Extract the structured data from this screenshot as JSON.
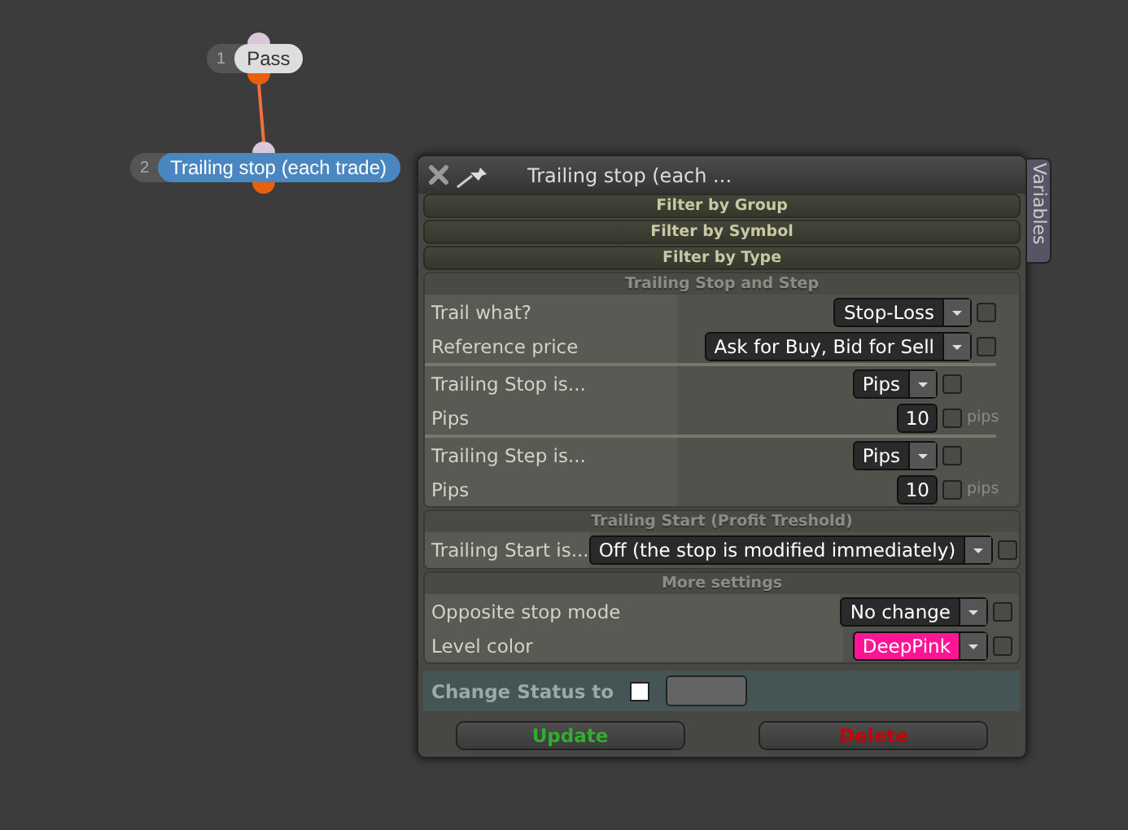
{
  "nodes": [
    {
      "number": "1",
      "label": "Pass",
      "selected": false
    },
    {
      "number": "2",
      "label": "Trailing stop (each trade)",
      "selected": true
    }
  ],
  "panel": {
    "title": "Trailing stop (each ...",
    "side_tab": "Variables",
    "filters": [
      "Filter by Group",
      "Filter by Symbol",
      "Filter by Type"
    ],
    "sections": [
      {
        "title": "Trailing Stop and Step",
        "groups": [
          [
            {
              "label": "Trail what?",
              "kind": "select",
              "value": "Stop-Loss",
              "checked": false
            },
            {
              "label": "Reference price",
              "kind": "select",
              "value": "Ask for Buy, Bid for Sell",
              "checked": false
            }
          ],
          [
            {
              "label": "Trailing Stop is...",
              "kind": "select",
              "value": "Pips",
              "checked": false
            },
            {
              "label": "Pips",
              "kind": "number",
              "value": "10",
              "unit": "pips",
              "checked": false
            }
          ],
          [
            {
              "label": "Trailing Step is...",
              "kind": "select",
              "value": "Pips",
              "checked": false
            },
            {
              "label": "Pips",
              "kind": "number",
              "value": "10",
              "unit": "pips",
              "checked": false
            }
          ]
        ]
      },
      {
        "title": "Trailing Start (Profit Treshold)",
        "groups": [
          [
            {
              "label": "Trailing Start is...",
              "kind": "select",
              "value": "Off (the stop is modified immediately)",
              "checked": false
            }
          ]
        ]
      },
      {
        "title": "More settings",
        "groups": [
          [
            {
              "label": "Opposite stop mode",
              "kind": "select",
              "value": "No change",
              "checked": false
            },
            {
              "label": "Level color",
              "kind": "select",
              "value": "DeepPink",
              "color": "#ff1493",
              "checked": false
            }
          ]
        ]
      }
    ],
    "status": {
      "label": "Change Status to",
      "checked": false
    },
    "buttons": [
      {
        "label": "Update",
        "kind": "update"
      },
      {
        "label": "Delete",
        "kind": "delete"
      }
    ]
  }
}
